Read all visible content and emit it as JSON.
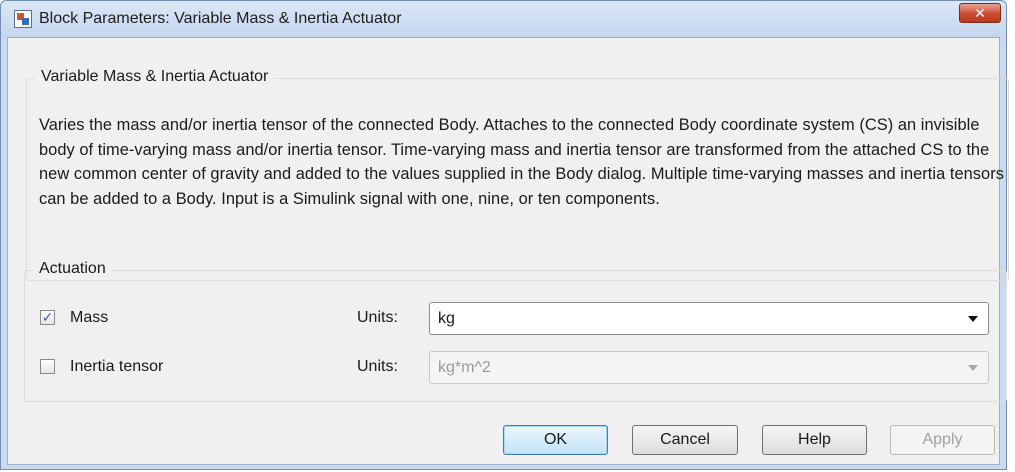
{
  "window": {
    "title": "Block Parameters: Variable Mass & Inertia Actuator",
    "close_glyph": "✕"
  },
  "description_group": {
    "title": "Variable Mass & Inertia Actuator",
    "text": "Varies the mass and/or inertia tensor of the connected Body. Attaches to the connected Body coordinate system (CS) an invisible body of time-varying mass and/or inertia tensor. Time-varying mass and inertia tensor are transformed from the attached CS to the new common center of gravity and added to the values supplied in the Body dialog. Multiple time-varying masses and inertia tensors can be added to a Body. Input is a Simulink signal with one, nine, or ten components."
  },
  "actuation_group": {
    "title": "Actuation",
    "mass": {
      "label": "Mass",
      "checked": true,
      "units_label": "Units:",
      "units_value": "kg",
      "enabled": true
    },
    "inertia": {
      "label": "Inertia tensor",
      "checked": false,
      "units_label": "Units:",
      "units_value": "kg*m^2",
      "enabled": false
    }
  },
  "buttons": {
    "ok": "OK",
    "cancel": "Cancel",
    "help": "Help",
    "apply": "Apply"
  },
  "icons": {
    "app": "simulink-block-icon",
    "close": "close-icon",
    "checkmark": "checkmark-icon",
    "dropdown": "chevron-down-icon"
  },
  "colors": {
    "titlebar": "#c4d6ef",
    "close_button": "#c94c33",
    "dialog_bg": "#f0f0f0",
    "default_button_border": "#3c7fb1"
  }
}
